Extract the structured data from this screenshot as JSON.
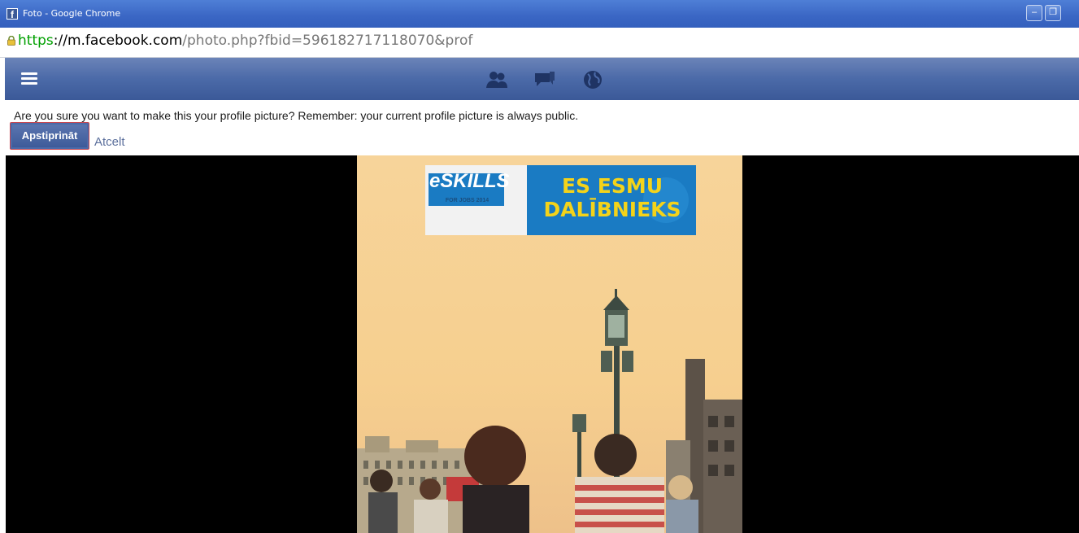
{
  "window": {
    "title": "Foto - Google Chrome",
    "fb_glyph": "f",
    "minimize_glyph": "–",
    "restore_glyph": "❐"
  },
  "address": {
    "scheme": "https",
    "host": "://m.facebook.com",
    "rest": "/photo.php?fbid=596182717118070&prof"
  },
  "prompt": {
    "text": "Are you sure you want to make this your profile picture? Remember: your current profile picture is always public.",
    "confirm_label": "Apstiprināt",
    "cancel_label": "Atcelt"
  },
  "navbar": {
    "icons": [
      "menu-icon",
      "friends-icon",
      "messages-icon",
      "globe-icon"
    ]
  },
  "photo": {
    "logo_text": "eSKILLS",
    "logo_sub": "FOR JOBS 2014",
    "banner_line1": "ES ESMU",
    "banner_line2": "DALĪBNIEKS"
  },
  "colors": {
    "fb_blue": "#3b5998",
    "chrome_blue": "#3a66c4",
    "banner_blue": "#1a7bc3",
    "banner_text": "#f4d31a",
    "sky": "#f7d49a"
  }
}
